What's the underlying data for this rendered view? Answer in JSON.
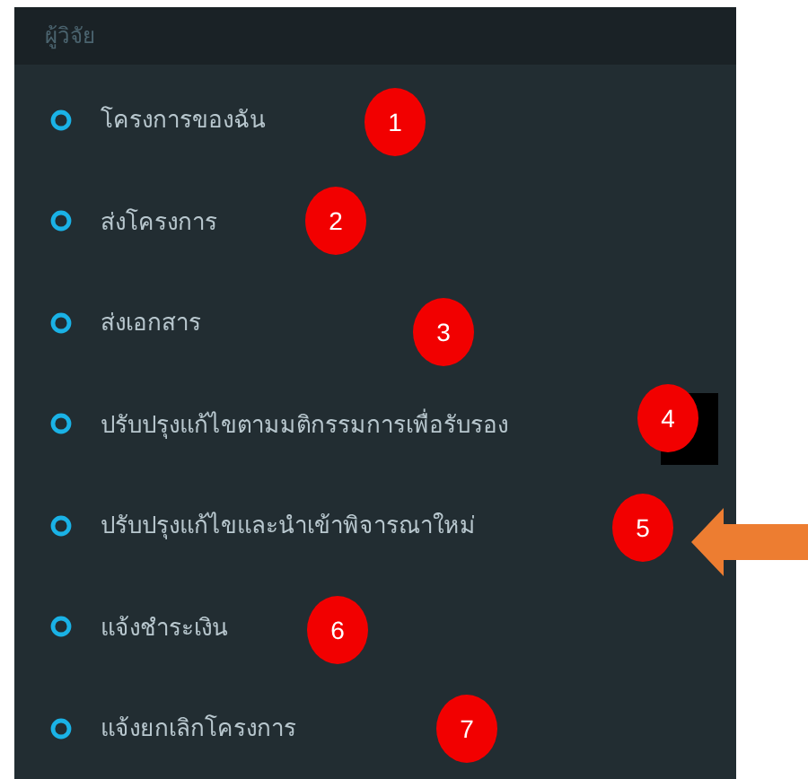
{
  "sidebar": {
    "header": "ผู้วิจัย",
    "items": [
      {
        "label": "โครงการของฉัน",
        "badge": "1"
      },
      {
        "label": "ส่งโครงการ",
        "badge": "2"
      },
      {
        "label": "ส่งเอกสาร",
        "badge": "3"
      },
      {
        "label": "ปรับปรุงแก้ไขตามมติกรรมการเพื่อรับรอง",
        "badge": "4",
        "redacted": true
      },
      {
        "label": "ปรับปรุงแก้ไขและนำเข้าพิจารณาใหม่",
        "badge": "5",
        "pointed": true
      },
      {
        "label": "แจ้งชำระเงิน",
        "badge": "6"
      },
      {
        "label": "แจ้งยกเลิกโครงการ",
        "badge": "7"
      }
    ]
  }
}
